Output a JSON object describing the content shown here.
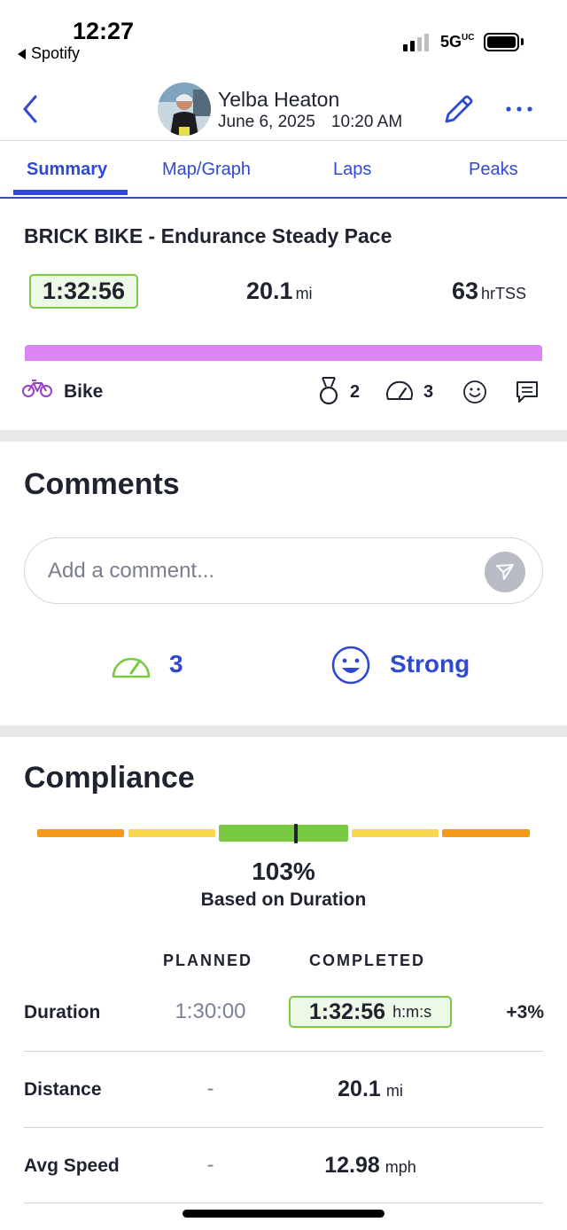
{
  "status_bar": {
    "time": "12:27",
    "back_app": "Spotify",
    "network": "5G",
    "network_suffix": "UC"
  },
  "header": {
    "athlete_name": "Yelba Heaton",
    "date": "June 6, 2025",
    "time": "10:20 AM"
  },
  "tabs": [
    {
      "label": "Summary",
      "active": true
    },
    {
      "label": "Map/Graph",
      "active": false
    },
    {
      "label": "Laps",
      "active": false
    },
    {
      "label": "Peaks",
      "active": false
    }
  ],
  "workout": {
    "title": "BRICK BIKE - Endurance Steady Pace",
    "duration": "1:32:56",
    "distance": "20.1",
    "distance_unit": "mi",
    "tss": "63",
    "tss_unit": "hrTSS",
    "color_bar": "#dd84f5",
    "sport": "Bike",
    "medals": "2",
    "rpe": "3"
  },
  "comments": {
    "title": "Comments",
    "placeholder": "Add a comment...",
    "rpe_value": "3",
    "feeling": "Strong"
  },
  "compliance": {
    "title": "Compliance",
    "percent": "103%",
    "percent_value": 103,
    "basis": "Based on Duration",
    "planned_header": "PLANNED",
    "completed_header": "COMPLETED",
    "rows": [
      {
        "label": "Duration",
        "planned": "1:30:00",
        "completed": "1:32:56",
        "unit": "h:m:s",
        "delta": "+3%"
      },
      {
        "label": "Distance",
        "planned": "-",
        "completed": "20.1",
        "unit": "mi",
        "delta": ""
      },
      {
        "label": "Avg Speed",
        "planned": "-",
        "completed": "12.98",
        "unit": "mph",
        "delta": ""
      }
    ]
  },
  "colors": {
    "accent": "#2f49d1",
    "compliance_green": "#7ac943",
    "compliance_yellow": "#f8d64e",
    "compliance_orange": "#f59a1b",
    "bike_purple": "#9b3fc9"
  }
}
